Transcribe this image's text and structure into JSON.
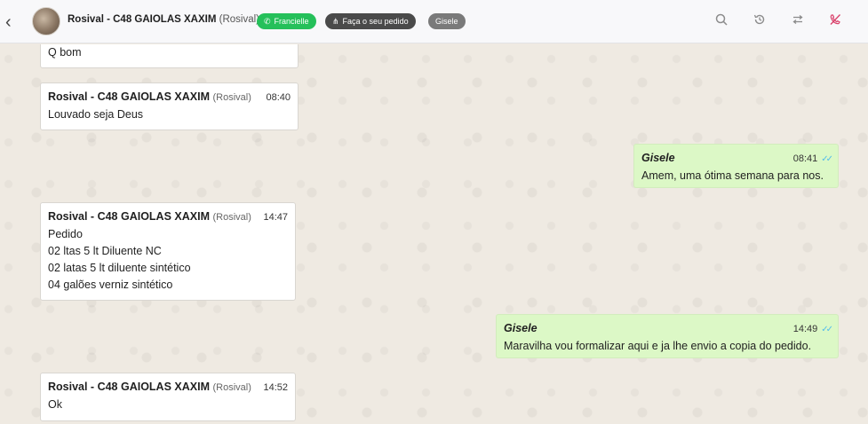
{
  "header": {
    "contact_name": "Rosival - C48 GAIOLAS XAXIM",
    "contact_sub": "(Rosival)",
    "tags": [
      {
        "label": "Francielle",
        "icon": "whatsapp-icon",
        "color": "#25c05a"
      },
      {
        "label": "Faça o seu pedido",
        "icon": "sitemap-icon",
        "color": "#4a4a4a"
      },
      {
        "label": "Gisele",
        "color": "#7a7a7a"
      }
    ]
  },
  "messages": [
    {
      "direction": "in",
      "lines": [
        "Q bom"
      ]
    },
    {
      "direction": "in",
      "sender": "Rosival - C48 GAIOLAS XAXIM",
      "sender_sub": "(Rosival)",
      "time": "08:40",
      "lines": [
        "Louvado seja Deus"
      ]
    },
    {
      "direction": "out",
      "sender": "Gisele",
      "time": "08:41",
      "lines": [
        "Amem, uma ótima semana para nos."
      ]
    },
    {
      "direction": "in",
      "sender": "Rosival - C48 GAIOLAS XAXIM",
      "sender_sub": "(Rosival)",
      "time": "14:47",
      "lines": [
        "Pedido",
        "02 ltas 5 lt Diluente NC",
        "02 latas 5 lt diluente sintético",
        "04 galões verniz sintético"
      ]
    },
    {
      "direction": "out",
      "sender": "Gisele",
      "time": "14:49",
      "lines": [
        "Maravilha vou formalizar aqui e ja lhe envio a copia do pedido."
      ]
    },
    {
      "direction": "in",
      "sender": "Rosival - C48 GAIOLAS XAXIM",
      "sender_sub": "(Rosival)",
      "time": "14:52",
      "lines": [
        "Ok"
      ]
    }
  ],
  "colors": {
    "outgoing_bubble": "#dcf8c6",
    "incoming_bubble": "#ffffff",
    "read_ticks": "#53bdeb",
    "end_chat_icon": "#d9406a"
  }
}
